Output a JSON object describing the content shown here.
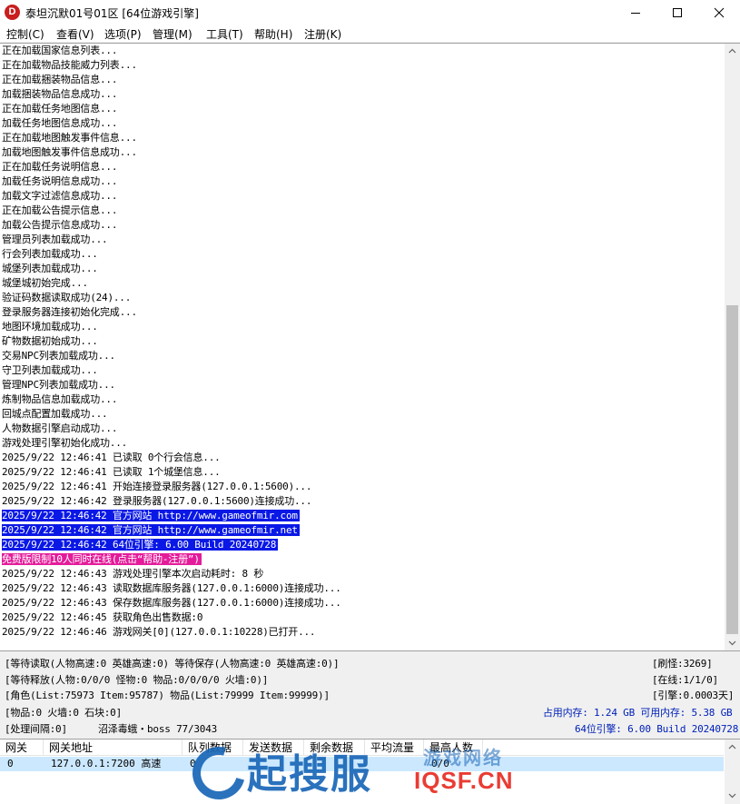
{
  "window": {
    "app_icon_letter": "D",
    "title": "泰坦沉默01号01区 [64位游戏引擎]"
  },
  "menu": [
    "控制(C)",
    "查看(V)",
    "选项(P)",
    "管理(M)",
    "工具(T)",
    "帮助(H)",
    "注册(K)"
  ],
  "log": {
    "lines": [
      "正在加载国家信息列表...",
      "正在加载物品技能威力列表...",
      "正在加载捆装物品信息...",
      "加载捆装物品信息成功...",
      "正在加载任务地图信息...",
      "加载任务地图信息成功...",
      "正在加载地图触发事件信息...",
      "加载地图触发事件信息成功...",
      "正在加载任务说明信息...",
      "加载任务说明信息成功...",
      "加载文字过滤信息成功...",
      "正在加载公告提示信息...",
      "加载公告提示信息成功...",
      "管理员列表加载成功...",
      "行会列表加载成功...",
      "城堡列表加载成功...",
      "城堡城初始完成...",
      "验证码数据读取成功(24)...",
      "登录服务器连接初始化完成...",
      "地图环境加载成功...",
      "矿物数据初始成功...",
      "交易NPC列表加载成功...",
      "守卫列表加载成功...",
      "管理NPC列表加载成功...",
      "炼制物品信息加载成功...",
      "回城点配置加载成功...",
      "人物数据引擎启动成功...",
      "游戏处理引擎初始化成功...",
      "2025/9/22 12:46:41 已读取 0个行会信息...",
      "2025/9/22 12:46:41 已读取 1个城堡信息...",
      "2025/9/22 12:46:41 开始连接登录服务器(127.0.0.1:5600)...",
      "2025/9/22 12:46:42 登录服务器(127.0.0.1:5600)连接成功...",
      "2025/9/22 12:46:42 官方网站 http://www.gameofmir.com",
      "2025/9/22 12:46:42 官方网站 http://www.gameofmir.net",
      "2025/9/22 12:46:42 64位引擎: 6.00 Build 20240728",
      "免费版限制10人同时在线(点击“帮助-注册”)",
      "2025/9/22 12:46:43 游戏处理引擎本次启动耗时: 8 秒",
      "2025/9/22 12:46:43 读取数据库服务器(127.0.0.1:6000)连接成功...",
      "2025/9/22 12:46:43 保存数据库服务器(127.0.0.1:6000)连接成功...",
      "2025/9/22 12:46:45 获取角色出售数据:0",
      "2025/9/22 12:46:46 游戏网关[0](127.0.0.1:10228)已打开..."
    ],
    "highlight_blue_indices": [
      32,
      33,
      34
    ],
    "highlight_magenta_indices": [
      35
    ],
    "highlight_colors": {
      "blue": "#0a18e6",
      "magenta": "#e41c9a"
    }
  },
  "status": {
    "row1_left": "[等待读取(人物高速:0 英雄高速:0) 等待保存(人物高速:0 英雄高速:0)]",
    "row1_right": "[刷怪:3269]",
    "row2_left": "[等待释放(人物:0/0/0 怪物:0 物品:0/0/0/0 火墙:0)]",
    "row2_right": "[在线:1/1/0]",
    "row3_left": "[角色(List:75973 Item:95787) 物品(List:79999 Item:99999)]",
    "row3_right": "[引擎:0.0003天]",
    "row4_left": "[物品:0 火墙:0 石块:0]",
    "row4_right": "占用内存: 1.24 GB 可用内存: 5.38 GB",
    "row5_left": "[处理间隔:0]",
    "row5_mid": "沼泽毒蛾・boss 77/3043",
    "row5_right": "64位引擎: 6.00 Build 20240728"
  },
  "gateway_table": {
    "columns": [
      "网关",
      "网关地址",
      "队列数据",
      "发送数据",
      "剩余数据",
      "平均流量",
      "最高人数"
    ],
    "rows": [
      {
        "gate": "0",
        "address": "127.0.0.1:7200 高速",
        "queue": "0",
        "send": "",
        "remain": "",
        "avg": "",
        "max": "0/0"
      }
    ]
  },
  "watermark": {
    "text_big": "起搜服",
    "text_top": "游戏网络",
    "text_url": "IQSF.CN"
  }
}
